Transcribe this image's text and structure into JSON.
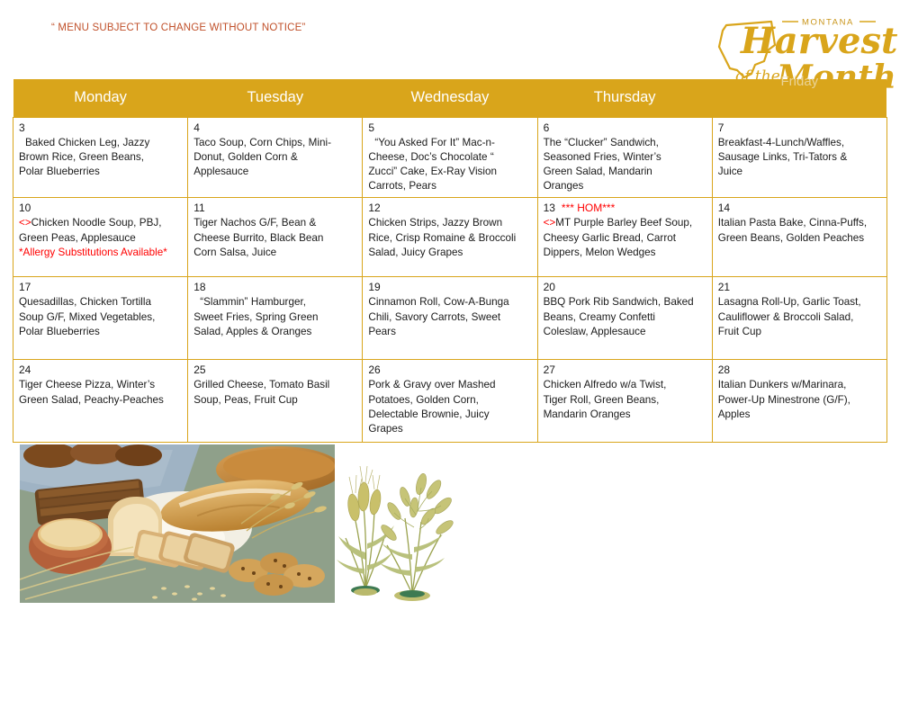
{
  "notice": "“ MENU SUBJECT TO CHANGE WITHOUT NOTICE”",
  "logo": {
    "state_label": "MONTANA",
    "line1": "Harvest",
    "line2": "of the Month",
    "color": "#D9A51B"
  },
  "colors": {
    "header_gold": "#D9A51B",
    "border_gold": "#D9A51B",
    "notice_red": "#C0502A",
    "accent_red": "#FF0000",
    "header_text": "#FFFFFF"
  },
  "calendar": {
    "headers": [
      "Monday",
      "Tuesday",
      "Wednesday",
      "Thursday",
      "Friday"
    ],
    "weeks": [
      [
        {
          "day": "3",
          "flag": "",
          "lines": [
            "Baked Chicken Leg, Jazzy",
            "Brown Rice, Green Beans,",
            "Polar Blueberries"
          ],
          "indent_first": true,
          "marker": "",
          "note": ""
        },
        {
          "day": "4",
          "flag": "",
          "lines": [
            "Taco Soup, Corn Chips, Mini-",
            "Donut, Golden Corn &",
            "Applesauce"
          ],
          "indent_first": false,
          "marker": "",
          "note": ""
        },
        {
          "day": "5",
          "flag": "",
          "lines": [
            "“You Asked For It” Mac-n-",
            "Cheese, Doc’s Chocolate “",
            "Zucci” Cake, Ex-Ray Vision",
            "Carrots, Pears"
          ],
          "indent_first": true,
          "marker": "",
          "note": ""
        },
        {
          "day": "6",
          "flag": "",
          "lines": [
            "The “Clucker” Sandwich,",
            "Seasoned Fries, Winter’s",
            "Green Salad, Mandarin",
            "Oranges"
          ],
          "indent_first": false,
          "marker": "",
          "note": ""
        },
        {
          "day": "7",
          "flag": "",
          "lines": [
            "Breakfast-4-Lunch/Waffles,",
            "Sausage Links, Tri-Tators &",
            "Juice"
          ],
          "indent_first": false,
          "marker": "",
          "note": ""
        }
      ],
      [
        {
          "day": "10",
          "flag": "",
          "lines": [
            "Chicken Noodle Soup, PBJ,",
            "Green Peas, Applesauce"
          ],
          "indent_first": false,
          "marker": "<>",
          "note": "*Allergy Substitutions Available*"
        },
        {
          "day": "11",
          "flag": "",
          "lines": [
            "Tiger Nachos G/F, Bean &",
            "Cheese Burrito, Black Bean",
            "Corn Salsa, Juice"
          ],
          "indent_first": false,
          "marker": "",
          "note": ""
        },
        {
          "day": "12",
          "flag": "",
          "lines": [
            "Chicken Strips, Jazzy Brown",
            "Rice, Crisp Romaine & Broccoli",
            "Salad, Juicy Grapes"
          ],
          "indent_first": false,
          "marker": "",
          "note": ""
        },
        {
          "day": "13",
          "flag": "*** HOM***",
          "lines": [
            "MT Purple Barley Beef Soup,",
            "Cheesy Garlic Bread, Carrot",
            "Dippers, Melon Wedges"
          ],
          "indent_first": false,
          "marker": "<>",
          "note": ""
        },
        {
          "day": "14",
          "flag": "",
          "lines": [
            "Italian Pasta Bake, Cinna-Puffs,",
            "Green Beans, Golden Peaches"
          ],
          "indent_first": false,
          "marker": "",
          "note": ""
        }
      ],
      [
        {
          "day": "17",
          "flag": "",
          "lines": [
            "Quesadillas, Chicken Tortilla",
            "Soup G/F, Mixed Vegetables,",
            "Polar Blueberries"
          ],
          "indent_first": false,
          "marker": "",
          "note": ""
        },
        {
          "day": "18",
          "flag": "",
          "lines": [
            "“Slammin” Hamburger,",
            "Sweet Fries, Spring Green",
            "Salad, Apples & Oranges"
          ],
          "indent_first": true,
          "marker": "",
          "note": ""
        },
        {
          "day": "19",
          "flag": "",
          "lines": [
            "Cinnamon Roll, Cow-A-Bunga",
            "Chili, Savory Carrots, Sweet",
            "Pears"
          ],
          "indent_first": false,
          "marker": "",
          "note": ""
        },
        {
          "day": "20",
          "flag": "",
          "lines": [
            "BBQ Pork Rib Sandwich, Baked",
            "Beans, Creamy Confetti",
            "Coleslaw, Applesauce"
          ],
          "indent_first": false,
          "marker": "",
          "note": ""
        },
        {
          "day": "21",
          "flag": "",
          "lines": [
            "Lasagna Roll-Up, Garlic Toast,",
            "Cauliflower & Broccoli Salad,",
            "Fruit Cup"
          ],
          "indent_first": false,
          "marker": "",
          "note": ""
        }
      ],
      [
        {
          "day": "24",
          "flag": "",
          "lines": [
            "Tiger Cheese Pizza, Winter’s",
            "Green Salad, Peachy-Peaches"
          ],
          "indent_first": false,
          "marker": "",
          "note": ""
        },
        {
          "day": "25",
          "flag": "",
          "lines": [
            "Grilled Cheese, Tomato Basil",
            "Soup,  Peas,  Fruit Cup"
          ],
          "indent_first": false,
          "marker": "",
          "note": ""
        },
        {
          "day": "26",
          "flag": "",
          "lines": [
            "Pork & Gravy over Mashed",
            "Potatoes, Golden Corn,",
            "Delectable Brownie, Juicy",
            "Grapes"
          ],
          "indent_first": false,
          "marker": "",
          "note": ""
        },
        {
          "day": "27",
          "flag": "",
          "lines": [
            "Chicken Alfredo w/a Twist,",
            "Tiger Roll, Green Beans,",
            "Mandarin Oranges"
          ],
          "indent_first": false,
          "marker": "",
          "note": ""
        },
        {
          "day": "28",
          "flag": "",
          "lines": [
            "Italian Dunkers w/Marinara,",
            "Power-Up Minestrone (G/F),",
            "Apples"
          ],
          "indent_first": false,
          "marker": "",
          "note": ""
        }
      ]
    ]
  },
  "images": {
    "bread_photo_alt": "assorted breads, rolls, cookies, oat grains and flour on a cloth",
    "grain_illustration_alt": "botanical illustration of wheat and oat plants"
  }
}
